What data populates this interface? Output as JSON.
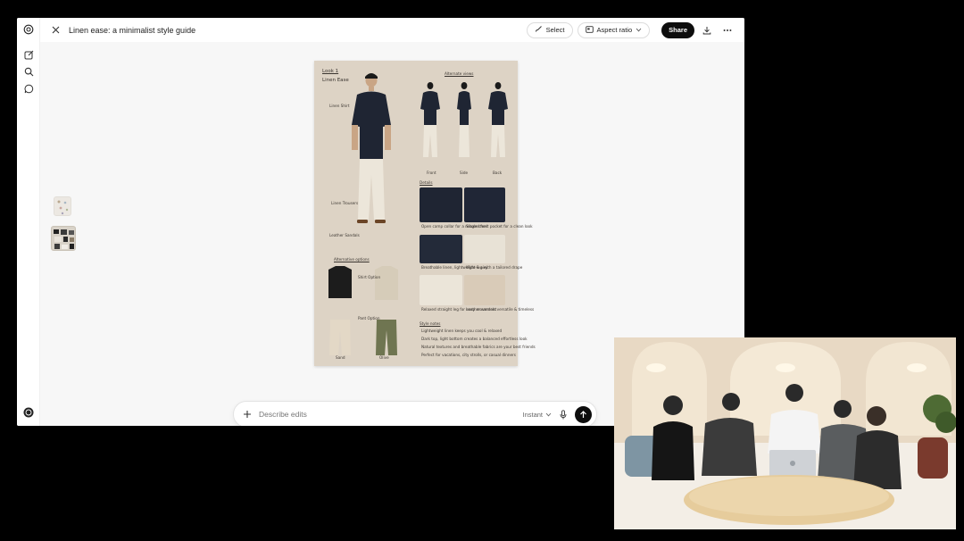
{
  "header": {
    "title": "Linen ease: a minimalist style guide",
    "select_label": "Select",
    "aspect_label": "Aspect ratio",
    "share_label": "Share"
  },
  "rail": {
    "icons": [
      "app-logo-icon",
      "new-chat-icon",
      "search-icon",
      "chat-icon",
      "account-icon"
    ]
  },
  "composer": {
    "placeholder": "Describe edits",
    "mode_label": "Instant"
  },
  "sheet": {
    "look_title": "Look 1",
    "look_subtitle": "Linen Ease",
    "alt_views_title": "Alternate views",
    "alt_views_labels": [
      "Front",
      "Side",
      "Back"
    ],
    "details_title": "Details",
    "detail_captions": [
      "Open camp collar for a relaxed feel",
      "Single chest pocket for a clean look",
      "Breathable linen, lightweight & airy",
      "Wide-leg with a tailored drape",
      "Relaxed straight leg for easy movement",
      "Leather sandals versatile & timeless"
    ],
    "callouts": [
      "Linen Shirt",
      "Linen Trousers",
      "Leather Sandals"
    ],
    "alt_options_title": "Alternative options",
    "alt_options_notes": [
      "Shirt Option",
      "Pant Option"
    ],
    "alt_options_labels": [
      "Sand",
      "Olive"
    ],
    "style_notes_title": "Style notes",
    "style_notes": [
      "Lightweight linen keeps you cool & relaxed",
      "Dark top, light bottom creates a balanced effortless look",
      "Natural textures and breathable fabrics are your best friends",
      "Perfect for vacations, city strolls, or casual dinners"
    ]
  },
  "colors": {
    "accent": "#0d0d0d",
    "sheet_bg": "#ddd3c5",
    "canvas_bg": "#f7f7f7",
    "shirt_navy": "#1f2533",
    "trouser_cream": "#ece6da",
    "olive": "#6f7551"
  }
}
